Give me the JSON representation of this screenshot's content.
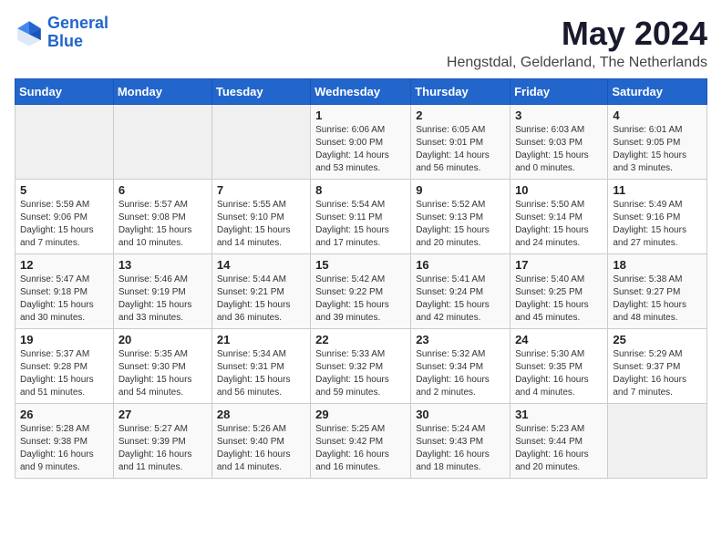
{
  "logo": {
    "line1": "General",
    "line2": "Blue"
  },
  "title": "May 2024",
  "subtitle": "Hengstdal, Gelderland, The Netherlands",
  "headers": [
    "Sunday",
    "Monday",
    "Tuesday",
    "Wednesday",
    "Thursday",
    "Friday",
    "Saturday"
  ],
  "weeks": [
    [
      {
        "day": "",
        "empty": true
      },
      {
        "day": "",
        "empty": true
      },
      {
        "day": "",
        "empty": true
      },
      {
        "day": "1",
        "sunrise": "Sunrise: 6:06 AM",
        "sunset": "Sunset: 9:00 PM",
        "daylight": "Daylight: 14 hours and 53 minutes."
      },
      {
        "day": "2",
        "sunrise": "Sunrise: 6:05 AM",
        "sunset": "Sunset: 9:01 PM",
        "daylight": "Daylight: 14 hours and 56 minutes."
      },
      {
        "day": "3",
        "sunrise": "Sunrise: 6:03 AM",
        "sunset": "Sunset: 9:03 PM",
        "daylight": "Daylight: 15 hours and 0 minutes."
      },
      {
        "day": "4",
        "sunrise": "Sunrise: 6:01 AM",
        "sunset": "Sunset: 9:05 PM",
        "daylight": "Daylight: 15 hours and 3 minutes."
      }
    ],
    [
      {
        "day": "5",
        "sunrise": "Sunrise: 5:59 AM",
        "sunset": "Sunset: 9:06 PM",
        "daylight": "Daylight: 15 hours and 7 minutes."
      },
      {
        "day": "6",
        "sunrise": "Sunrise: 5:57 AM",
        "sunset": "Sunset: 9:08 PM",
        "daylight": "Daylight: 15 hours and 10 minutes."
      },
      {
        "day": "7",
        "sunrise": "Sunrise: 5:55 AM",
        "sunset": "Sunset: 9:10 PM",
        "daylight": "Daylight: 15 hours and 14 minutes."
      },
      {
        "day": "8",
        "sunrise": "Sunrise: 5:54 AM",
        "sunset": "Sunset: 9:11 PM",
        "daylight": "Daylight: 15 hours and 17 minutes."
      },
      {
        "day": "9",
        "sunrise": "Sunrise: 5:52 AM",
        "sunset": "Sunset: 9:13 PM",
        "daylight": "Daylight: 15 hours and 20 minutes."
      },
      {
        "day": "10",
        "sunrise": "Sunrise: 5:50 AM",
        "sunset": "Sunset: 9:14 PM",
        "daylight": "Daylight: 15 hours and 24 minutes."
      },
      {
        "day": "11",
        "sunrise": "Sunrise: 5:49 AM",
        "sunset": "Sunset: 9:16 PM",
        "daylight": "Daylight: 15 hours and 27 minutes."
      }
    ],
    [
      {
        "day": "12",
        "sunrise": "Sunrise: 5:47 AM",
        "sunset": "Sunset: 9:18 PM",
        "daylight": "Daylight: 15 hours and 30 minutes."
      },
      {
        "day": "13",
        "sunrise": "Sunrise: 5:46 AM",
        "sunset": "Sunset: 9:19 PM",
        "daylight": "Daylight: 15 hours and 33 minutes."
      },
      {
        "day": "14",
        "sunrise": "Sunrise: 5:44 AM",
        "sunset": "Sunset: 9:21 PM",
        "daylight": "Daylight: 15 hours and 36 minutes."
      },
      {
        "day": "15",
        "sunrise": "Sunrise: 5:42 AM",
        "sunset": "Sunset: 9:22 PM",
        "daylight": "Daylight: 15 hours and 39 minutes."
      },
      {
        "day": "16",
        "sunrise": "Sunrise: 5:41 AM",
        "sunset": "Sunset: 9:24 PM",
        "daylight": "Daylight: 15 hours and 42 minutes."
      },
      {
        "day": "17",
        "sunrise": "Sunrise: 5:40 AM",
        "sunset": "Sunset: 9:25 PM",
        "daylight": "Daylight: 15 hours and 45 minutes."
      },
      {
        "day": "18",
        "sunrise": "Sunrise: 5:38 AM",
        "sunset": "Sunset: 9:27 PM",
        "daylight": "Daylight: 15 hours and 48 minutes."
      }
    ],
    [
      {
        "day": "19",
        "sunrise": "Sunrise: 5:37 AM",
        "sunset": "Sunset: 9:28 PM",
        "daylight": "Daylight: 15 hours and 51 minutes."
      },
      {
        "day": "20",
        "sunrise": "Sunrise: 5:35 AM",
        "sunset": "Sunset: 9:30 PM",
        "daylight": "Daylight: 15 hours and 54 minutes."
      },
      {
        "day": "21",
        "sunrise": "Sunrise: 5:34 AM",
        "sunset": "Sunset: 9:31 PM",
        "daylight": "Daylight: 15 hours and 56 minutes."
      },
      {
        "day": "22",
        "sunrise": "Sunrise: 5:33 AM",
        "sunset": "Sunset: 9:32 PM",
        "daylight": "Daylight: 15 hours and 59 minutes."
      },
      {
        "day": "23",
        "sunrise": "Sunrise: 5:32 AM",
        "sunset": "Sunset: 9:34 PM",
        "daylight": "Daylight: 16 hours and 2 minutes."
      },
      {
        "day": "24",
        "sunrise": "Sunrise: 5:30 AM",
        "sunset": "Sunset: 9:35 PM",
        "daylight": "Daylight: 16 hours and 4 minutes."
      },
      {
        "day": "25",
        "sunrise": "Sunrise: 5:29 AM",
        "sunset": "Sunset: 9:37 PM",
        "daylight": "Daylight: 16 hours and 7 minutes."
      }
    ],
    [
      {
        "day": "26",
        "sunrise": "Sunrise: 5:28 AM",
        "sunset": "Sunset: 9:38 PM",
        "daylight": "Daylight: 16 hours and 9 minutes."
      },
      {
        "day": "27",
        "sunrise": "Sunrise: 5:27 AM",
        "sunset": "Sunset: 9:39 PM",
        "daylight": "Daylight: 16 hours and 11 minutes."
      },
      {
        "day": "28",
        "sunrise": "Sunrise: 5:26 AM",
        "sunset": "Sunset: 9:40 PM",
        "daylight": "Daylight: 16 hours and 14 minutes."
      },
      {
        "day": "29",
        "sunrise": "Sunrise: 5:25 AM",
        "sunset": "Sunset: 9:42 PM",
        "daylight": "Daylight: 16 hours and 16 minutes."
      },
      {
        "day": "30",
        "sunrise": "Sunrise: 5:24 AM",
        "sunset": "Sunset: 9:43 PM",
        "daylight": "Daylight: 16 hours and 18 minutes."
      },
      {
        "day": "31",
        "sunrise": "Sunrise: 5:23 AM",
        "sunset": "Sunset: 9:44 PM",
        "daylight": "Daylight: 16 hours and 20 minutes."
      },
      {
        "day": "",
        "empty": true
      }
    ]
  ]
}
